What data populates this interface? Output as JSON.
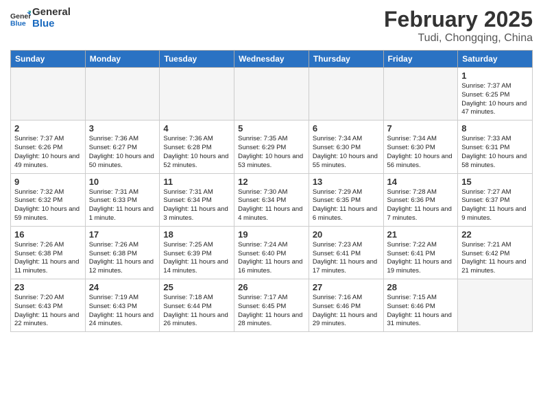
{
  "header": {
    "title": "February 2025",
    "subtitle": "Tudi, Chongqing, China"
  },
  "columns": [
    "Sunday",
    "Monday",
    "Tuesday",
    "Wednesday",
    "Thursday",
    "Friday",
    "Saturday"
  ],
  "weeks": [
    [
      {
        "day": "",
        "info": ""
      },
      {
        "day": "",
        "info": ""
      },
      {
        "day": "",
        "info": ""
      },
      {
        "day": "",
        "info": ""
      },
      {
        "day": "",
        "info": ""
      },
      {
        "day": "",
        "info": ""
      },
      {
        "day": "1",
        "info": "Sunrise: 7:37 AM\nSunset: 6:25 PM\nDaylight: 10 hours and 47 minutes."
      }
    ],
    [
      {
        "day": "2",
        "info": "Sunrise: 7:37 AM\nSunset: 6:26 PM\nDaylight: 10 hours and 49 minutes."
      },
      {
        "day": "3",
        "info": "Sunrise: 7:36 AM\nSunset: 6:27 PM\nDaylight: 10 hours and 50 minutes."
      },
      {
        "day": "4",
        "info": "Sunrise: 7:36 AM\nSunset: 6:28 PM\nDaylight: 10 hours and 52 minutes."
      },
      {
        "day": "5",
        "info": "Sunrise: 7:35 AM\nSunset: 6:29 PM\nDaylight: 10 hours and 53 minutes."
      },
      {
        "day": "6",
        "info": "Sunrise: 7:34 AM\nSunset: 6:30 PM\nDaylight: 10 hours and 55 minutes."
      },
      {
        "day": "7",
        "info": "Sunrise: 7:34 AM\nSunset: 6:30 PM\nDaylight: 10 hours and 56 minutes."
      },
      {
        "day": "8",
        "info": "Sunrise: 7:33 AM\nSunset: 6:31 PM\nDaylight: 10 hours and 58 minutes."
      }
    ],
    [
      {
        "day": "9",
        "info": "Sunrise: 7:32 AM\nSunset: 6:32 PM\nDaylight: 10 hours and 59 minutes."
      },
      {
        "day": "10",
        "info": "Sunrise: 7:31 AM\nSunset: 6:33 PM\nDaylight: 11 hours and 1 minute."
      },
      {
        "day": "11",
        "info": "Sunrise: 7:31 AM\nSunset: 6:34 PM\nDaylight: 11 hours and 3 minutes."
      },
      {
        "day": "12",
        "info": "Sunrise: 7:30 AM\nSunset: 6:34 PM\nDaylight: 11 hours and 4 minutes."
      },
      {
        "day": "13",
        "info": "Sunrise: 7:29 AM\nSunset: 6:35 PM\nDaylight: 11 hours and 6 minutes."
      },
      {
        "day": "14",
        "info": "Sunrise: 7:28 AM\nSunset: 6:36 PM\nDaylight: 11 hours and 7 minutes."
      },
      {
        "day": "15",
        "info": "Sunrise: 7:27 AM\nSunset: 6:37 PM\nDaylight: 11 hours and 9 minutes."
      }
    ],
    [
      {
        "day": "16",
        "info": "Sunrise: 7:26 AM\nSunset: 6:38 PM\nDaylight: 11 hours and 11 minutes."
      },
      {
        "day": "17",
        "info": "Sunrise: 7:26 AM\nSunset: 6:38 PM\nDaylight: 11 hours and 12 minutes."
      },
      {
        "day": "18",
        "info": "Sunrise: 7:25 AM\nSunset: 6:39 PM\nDaylight: 11 hours and 14 minutes."
      },
      {
        "day": "19",
        "info": "Sunrise: 7:24 AM\nSunset: 6:40 PM\nDaylight: 11 hours and 16 minutes."
      },
      {
        "day": "20",
        "info": "Sunrise: 7:23 AM\nSunset: 6:41 PM\nDaylight: 11 hours and 17 minutes."
      },
      {
        "day": "21",
        "info": "Sunrise: 7:22 AM\nSunset: 6:41 PM\nDaylight: 11 hours and 19 minutes."
      },
      {
        "day": "22",
        "info": "Sunrise: 7:21 AM\nSunset: 6:42 PM\nDaylight: 11 hours and 21 minutes."
      }
    ],
    [
      {
        "day": "23",
        "info": "Sunrise: 7:20 AM\nSunset: 6:43 PM\nDaylight: 11 hours and 22 minutes."
      },
      {
        "day": "24",
        "info": "Sunrise: 7:19 AM\nSunset: 6:43 PM\nDaylight: 11 hours and 24 minutes."
      },
      {
        "day": "25",
        "info": "Sunrise: 7:18 AM\nSunset: 6:44 PM\nDaylight: 11 hours and 26 minutes."
      },
      {
        "day": "26",
        "info": "Sunrise: 7:17 AM\nSunset: 6:45 PM\nDaylight: 11 hours and 28 minutes."
      },
      {
        "day": "27",
        "info": "Sunrise: 7:16 AM\nSunset: 6:46 PM\nDaylight: 11 hours and 29 minutes."
      },
      {
        "day": "28",
        "info": "Sunrise: 7:15 AM\nSunset: 6:46 PM\nDaylight: 11 hours and 31 minutes."
      },
      {
        "day": "",
        "info": ""
      }
    ]
  ]
}
